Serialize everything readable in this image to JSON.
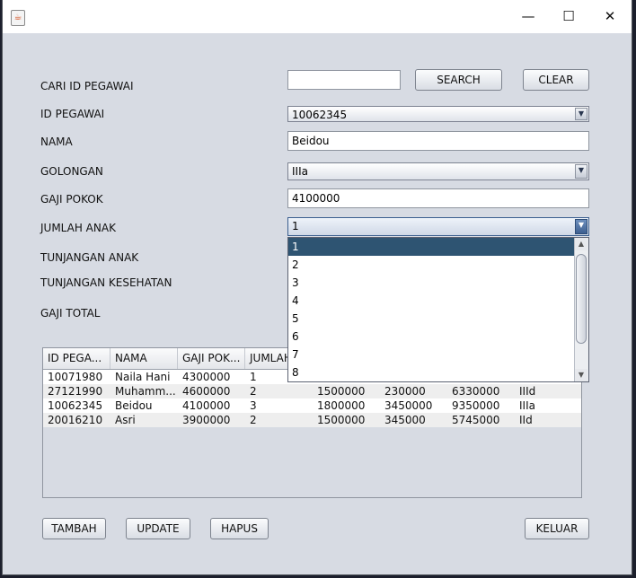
{
  "window": {
    "controls": {
      "minimize": "—",
      "maximize": "☐",
      "close": "✕"
    }
  },
  "form": {
    "cari_label": "CARI ID PEGAWAI",
    "cari_value": "",
    "search_button": "SEARCH",
    "clear_button": "CLEAR",
    "id_label": "ID PEGAWAI",
    "id_value": "10062345",
    "nama_label": "NAMA",
    "nama_value": "Beidou",
    "golongan_label": "GOLONGAN",
    "golongan_value": "IIIa",
    "gaji_pokok_label": "GAJI POKOK",
    "gaji_pokok_value": "4100000",
    "jumlah_anak_label": "JUMLAH ANAK",
    "jumlah_anak_value": "1",
    "tunjangan_anak_label": "TUNJANGAN ANAK",
    "tunjangan_kesehatan_label": "TUNJANGAN KESEHATAN",
    "gaji_total_label": "GAJI TOTAL"
  },
  "dropdown": {
    "options": [
      "1",
      "2",
      "3",
      "4",
      "5",
      "6",
      "7",
      "8"
    ],
    "selected_index": 0
  },
  "table": {
    "headers": [
      "ID PEGA...",
      "NAMA",
      "GAJI POK...",
      "JUMLAH..."
    ],
    "rows": [
      [
        "10071980",
        "Naila Hani",
        "4300000",
        "1",
        "",
        "",
        "",
        ""
      ],
      [
        "27121990",
        "Muhamm...",
        "4600000",
        "2",
        "1500000",
        "230000",
        "6330000",
        "IIId"
      ],
      [
        "10062345",
        "Beidou",
        "4100000",
        "3",
        "1800000",
        "3450000",
        "9350000",
        "IIIa"
      ],
      [
        "20016210",
        "Asri",
        "3900000",
        "2",
        "1500000",
        "345000",
        "5745000",
        "IId"
      ]
    ]
  },
  "buttons": {
    "tambah": "TAMBAH",
    "update": "UPDATE",
    "hapus": "HAPUS",
    "keluar": "KELUAR"
  }
}
